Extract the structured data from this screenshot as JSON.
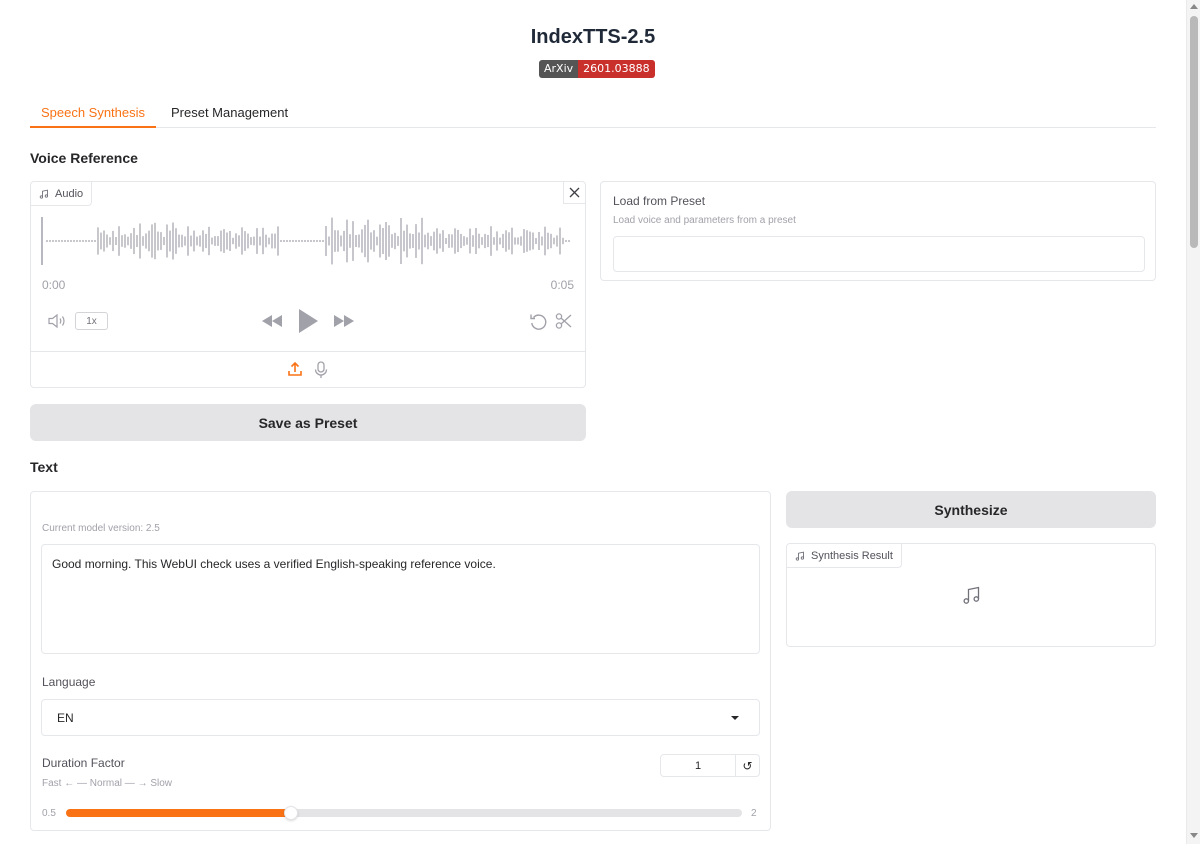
{
  "header": {
    "title": "IndexTTS-2.5",
    "badge_left": "ArXiv",
    "badge_right": "2601.03888"
  },
  "tabs": [
    {
      "label": "Speech Synthesis",
      "active": true
    },
    {
      "label": "Preset Management",
      "active": false
    }
  ],
  "voice_reference": {
    "section_label": "Voice Reference",
    "audio": {
      "label": "Audio",
      "time_start": "0:00",
      "time_end": "0:05",
      "speed": "1x"
    },
    "preset": {
      "label": "Load from Preset",
      "info": "Load voice and parameters from a preset",
      "value": ""
    },
    "save_button": "Save as Preset"
  },
  "text": {
    "section_label": "Text",
    "model_version": "Current model version: 2.5",
    "input_value": "Good morning. This WebUI check uses a verified English-speaking reference voice.",
    "language_label": "Language",
    "language_value": "EN",
    "duration": {
      "label": "Duration Factor",
      "info": "Fast ← — Normal — → Slow",
      "value": "1",
      "min": "0.5",
      "max": "2",
      "fill_fraction": 0.333
    }
  },
  "synthesis": {
    "button": "Synthesize",
    "result_label": "Synthesis Result"
  },
  "colors": {
    "accent": "#f97316",
    "badge_dark": "#555555",
    "badge_red": "#c9302c",
    "button_bg": "#e4e4e7"
  }
}
